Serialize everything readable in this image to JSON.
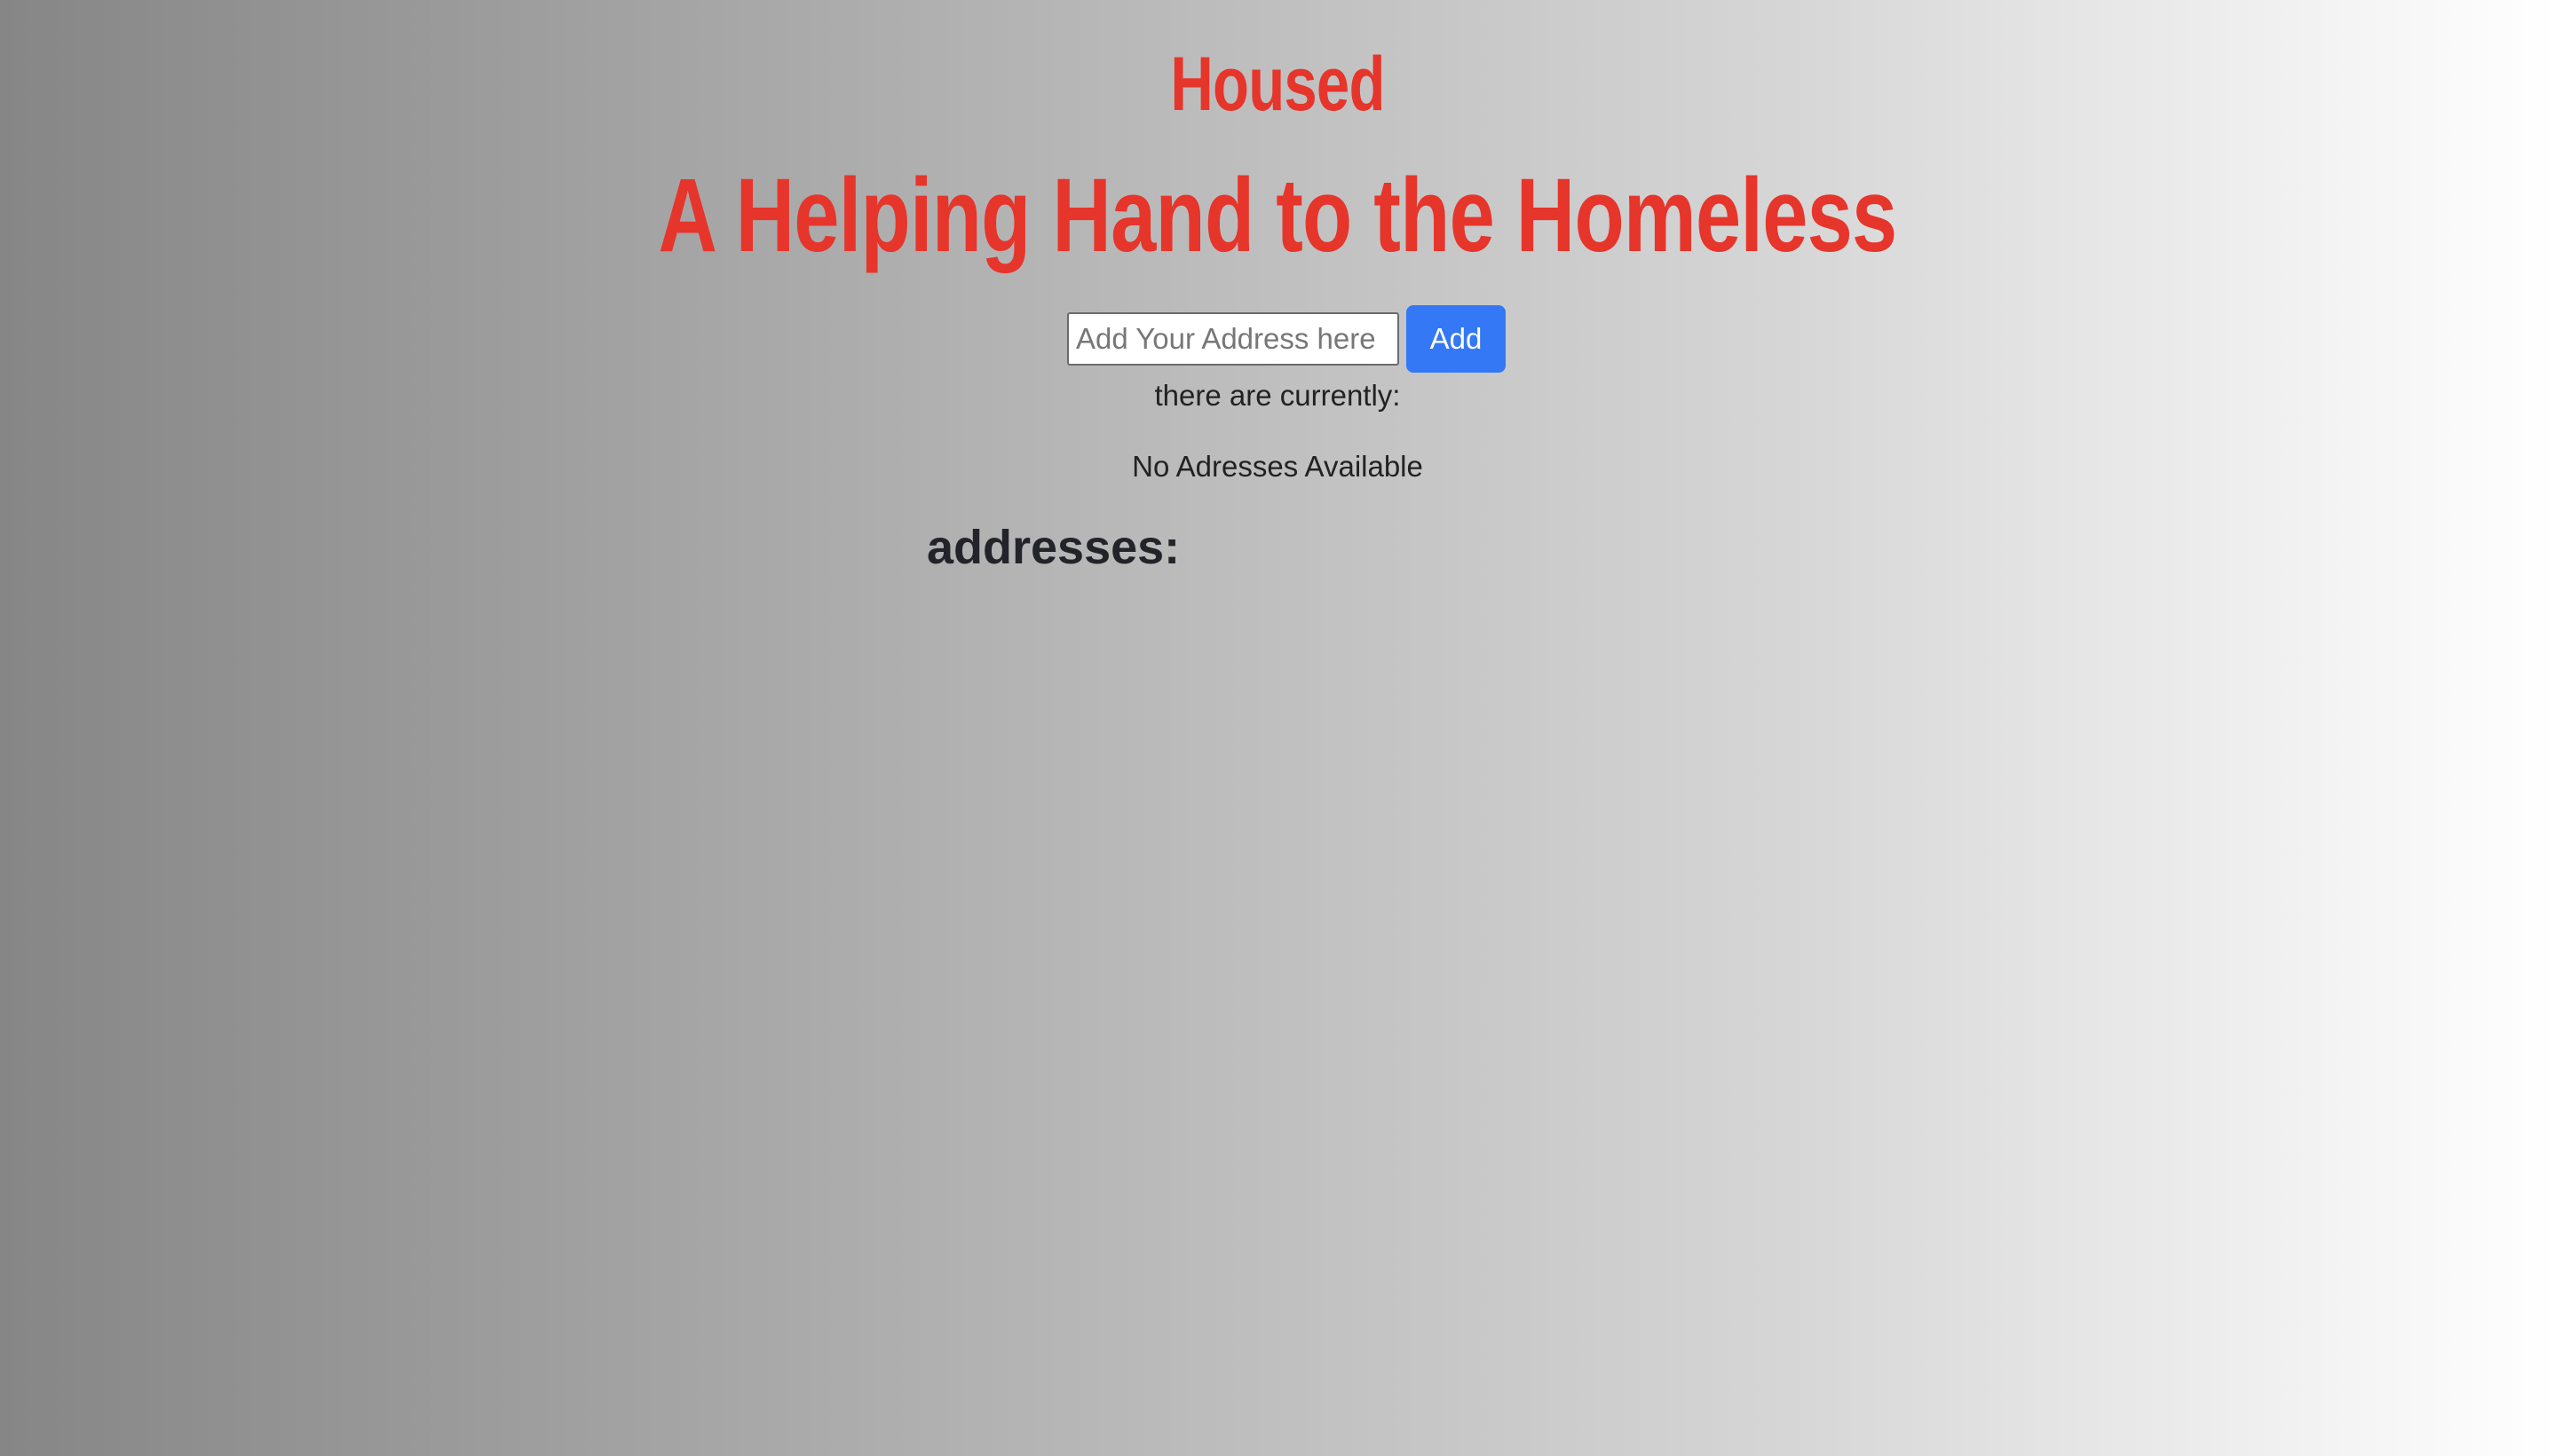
{
  "header": {
    "brand": "Housed",
    "tagline": "A Helping Hand to the Homeless"
  },
  "form": {
    "input_placeholder": "Add Your Address here",
    "input_value": "",
    "add_label": "Add"
  },
  "status": {
    "count_label": "there are currently:",
    "empty_message": "No Adresses Available"
  },
  "list": {
    "heading": "addresses:"
  },
  "colors": {
    "brand_red": "#e6352b",
    "button_blue": "#3478f6"
  }
}
